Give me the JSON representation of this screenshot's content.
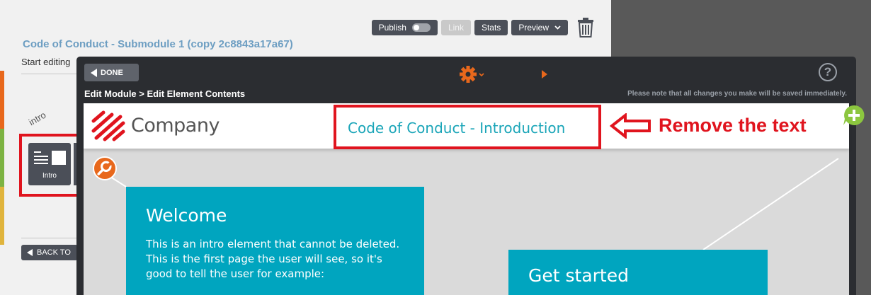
{
  "toolbar": {
    "publish_label": "Publish",
    "link_label": "Link",
    "stats_label": "Stats",
    "preview_label": "Preview"
  },
  "module": {
    "title": "Code of Conduct - Submodule 1 (copy 2c8843a17a67)",
    "start_editing": "Start editing"
  },
  "sidebar": {
    "rotated_label": "intro",
    "tile_label": "Intro",
    "back_label": "BACK TO"
  },
  "editor": {
    "done_label": "DONE",
    "breadcrumb": "Edit Module > Edit Element Contents",
    "notice": "Please note that all changes you make will be saved immediately."
  },
  "page": {
    "logo_text": "Company",
    "header_title": "Code of Conduct - Introduction",
    "annotation": "Remove the text",
    "card1": {
      "heading": "Welcome",
      "body": "This is an intro element that cannot be deleted. This is the first page the user will see, so it's good to tell the user for example:"
    },
    "card2": {
      "heading": "Get started"
    }
  },
  "colors": {
    "accent_teal": "#00a5bf",
    "annotation_red": "#e0141e",
    "brand_orange": "#e8681c"
  }
}
